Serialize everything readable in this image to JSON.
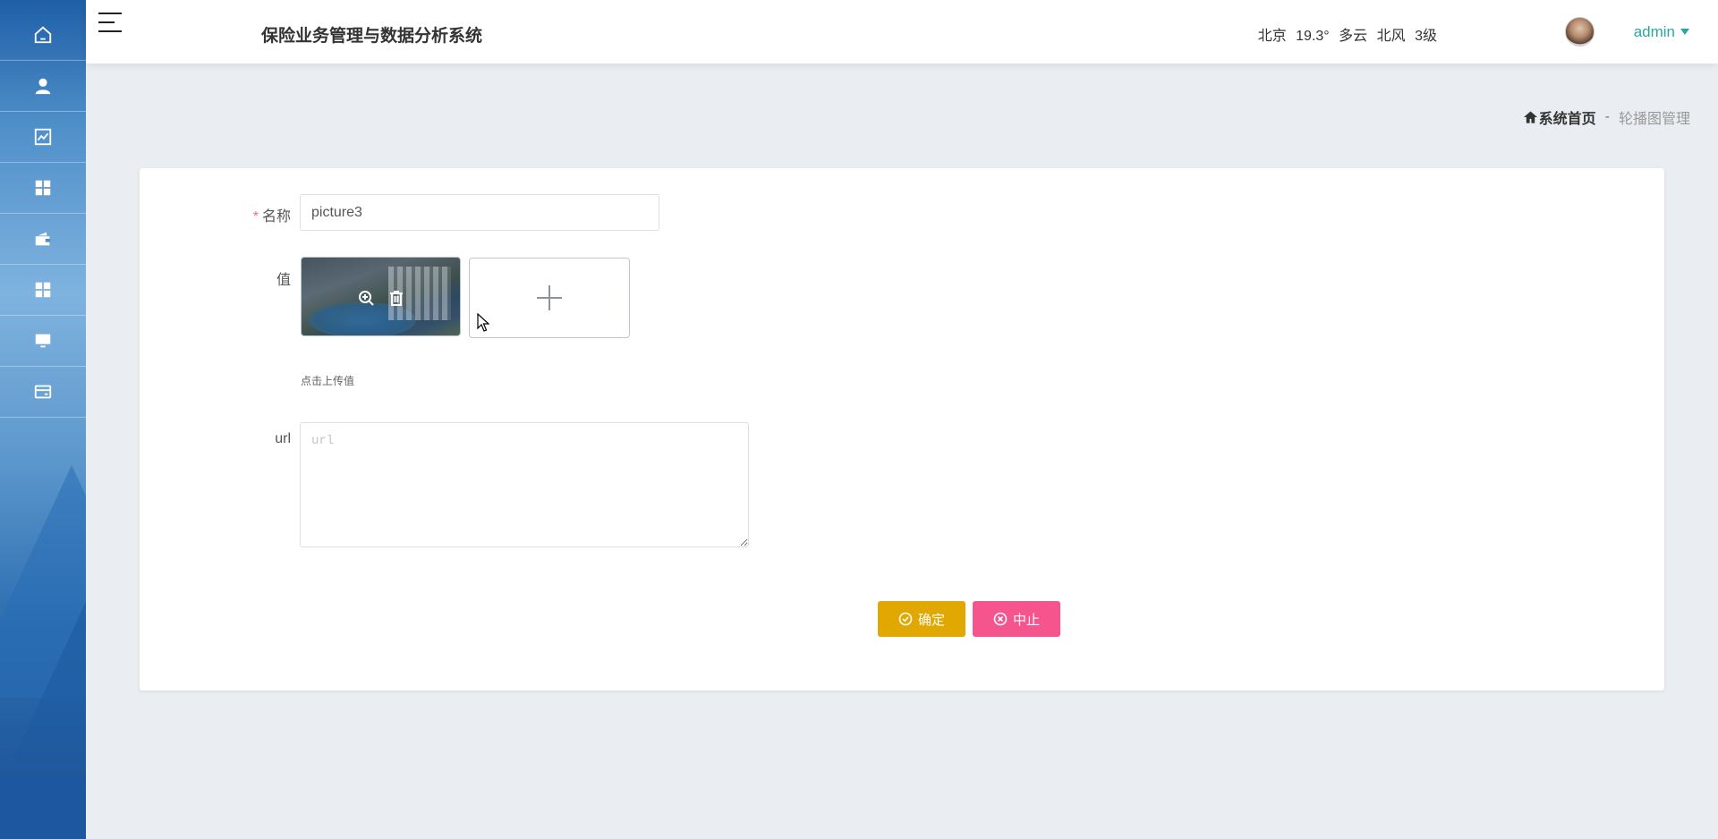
{
  "sidebar": {
    "items": [
      {
        "icon": "home-icon"
      },
      {
        "icon": "user-icon"
      },
      {
        "icon": "chart-line-icon"
      },
      {
        "icon": "grid-icon"
      },
      {
        "icon": "wallet-icon"
      },
      {
        "icon": "grid-icon"
      },
      {
        "icon": "monitor-icon"
      },
      {
        "icon": "card-icon"
      }
    ]
  },
  "header": {
    "title": "保险业务管理与数据分析系统",
    "weather": {
      "city": "北京",
      "temp": "19.3°",
      "condition": "多云",
      "wind": "北风",
      "level": "3级"
    },
    "user": "admin"
  },
  "breadcrumb": {
    "home": "系统首页",
    "separator": "-",
    "current": "轮播图管理"
  },
  "form": {
    "name_label": "名称",
    "name_required": "*",
    "name_value": "picture3",
    "value_label": "值",
    "upload_tip": "点击上传值",
    "url_label": "url",
    "url_placeholder": "url",
    "confirm_label": "确定",
    "stop_label": "中止"
  },
  "colors": {
    "accent": "#2aa7a0",
    "confirm": "#e0a800",
    "stop": "#f5558c",
    "required": "#f56c6c"
  }
}
